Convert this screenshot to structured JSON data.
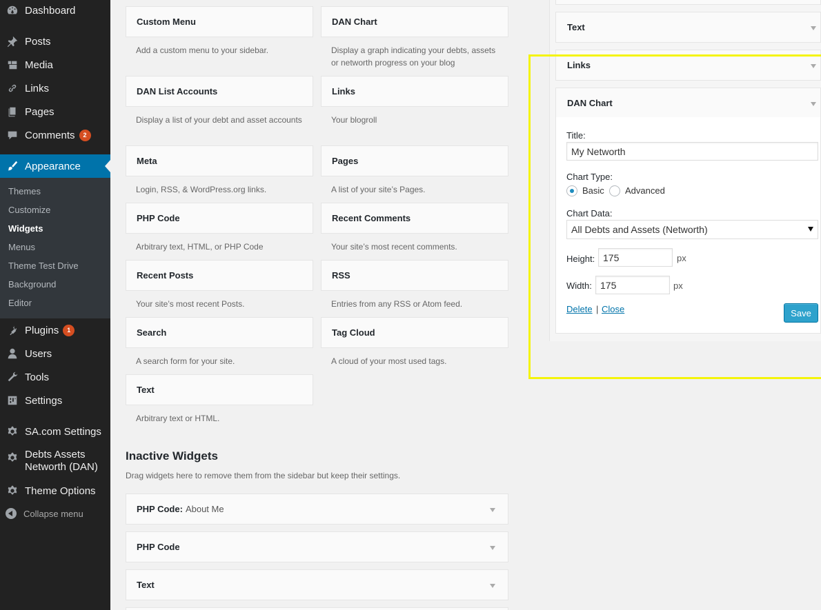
{
  "menu": {
    "dashboard": "Dashboard",
    "posts": "Posts",
    "media": "Media",
    "links": "Links",
    "pages": "Pages",
    "comments": "Comments",
    "comments_badge": "2",
    "appearance": "Appearance",
    "submenu": {
      "themes": "Themes",
      "customize": "Customize",
      "widgets": "Widgets",
      "menus": "Menus",
      "theme_test_drive": "Theme Test Drive",
      "background": "Background",
      "editor": "Editor"
    },
    "plugins": "Plugins",
    "plugins_badge": "1",
    "users": "Users",
    "tools": "Tools",
    "settings": "Settings",
    "sa_settings": "SA.com Settings",
    "dan_line1": "Debts Assets",
    "dan_line2": "Networth (DAN)",
    "theme_options": "Theme Options",
    "collapse": "Collapse menu"
  },
  "available_widgets": [
    {
      "title": "Custom Menu",
      "desc": "Add a custom menu to your sidebar."
    },
    {
      "title": "DAN Chart",
      "desc": "Display a graph indicating your debts, assets or networth progress on your blog"
    },
    {
      "title": "DAN List Accounts",
      "desc": "Display a list of your debt and asset accounts"
    },
    {
      "title": "Links",
      "desc": "Your blogroll"
    },
    {
      "title": "Meta",
      "desc": "Login, RSS, & WordPress.org links."
    },
    {
      "title": "Pages",
      "desc": "A list of your site’s Pages."
    },
    {
      "title": "PHP Code",
      "desc": "Arbitrary text, HTML, or PHP Code"
    },
    {
      "title": "Recent Comments",
      "desc": "Your site’s most recent comments."
    },
    {
      "title": "Recent Posts",
      "desc": "Your site’s most recent Posts."
    },
    {
      "title": "RSS",
      "desc": "Entries from any RSS or Atom feed."
    },
    {
      "title": "Search",
      "desc": "A search form for your site."
    },
    {
      "title": "Tag Cloud",
      "desc": "A cloud of your most used tags."
    },
    {
      "title": "Text",
      "desc": "Arbitrary text or HTML."
    }
  ],
  "inactive": {
    "title": "Inactive Widgets",
    "desc": "Drag widgets here to remove them from the sidebar but keep their settings.",
    "items": [
      {
        "title": "PHP Code:",
        "subtitle": "About Me"
      },
      {
        "title": "PHP Code",
        "subtitle": ""
      },
      {
        "title": "Text",
        "subtitle": ""
      }
    ]
  },
  "sidebar_widgets": {
    "text": "Text",
    "links": "Links",
    "dan_chart": "DAN Chart"
  },
  "dan_form": {
    "title_label": "Title:",
    "title_value": "My Networth",
    "chart_type_label": "Chart Type:",
    "chart_type_basic": "Basic",
    "chart_type_advanced": "Advanced",
    "chart_type_selected": "Basic",
    "chart_data_label": "Chart Data:",
    "chart_data_value": "All Debts and Assets (Networth)",
    "height_label": "Height:",
    "height_value": "175",
    "width_label": "Width:",
    "width_value": "175",
    "unit": "px",
    "delete": "Delete",
    "separator": "|",
    "close": "Close",
    "save": "Save"
  },
  "colors": {
    "menu_bg": "#222222",
    "accent": "#0073aa",
    "badge": "#d54e21",
    "save_button": "#2ea2cc",
    "highlight": "#f4f40a"
  }
}
